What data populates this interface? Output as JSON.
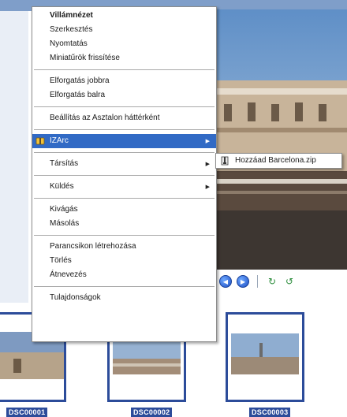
{
  "context_menu": {
    "items": [
      {
        "label": "Villámnézet",
        "bold": true
      },
      {
        "label": "Szerkesztés"
      },
      {
        "label": "Nyomtatás"
      },
      {
        "label": "Miniatűrök frissítése"
      },
      {
        "label": "Elforgatás jobbra"
      },
      {
        "label": "Elforgatás balra"
      },
      {
        "label": "Beállítás az Asztalon háttérként"
      },
      {
        "label": "IZArc",
        "icon": "izarc-icon",
        "submenu": true,
        "highlighted": true
      },
      {
        "label": "Társítás",
        "submenu": true
      },
      {
        "label": "Küldés",
        "submenu": true
      },
      {
        "label": "Kivágás"
      },
      {
        "label": "Másolás"
      },
      {
        "label": "Parancsikon létrehozása"
      },
      {
        "label": "Törlés"
      },
      {
        "label": "Átnevezés"
      },
      {
        "label": "Tulajdonságok"
      }
    ]
  },
  "submenu": {
    "items": [
      {
        "label": "Hozzáad Barcelona.zip",
        "icon": "archive-icon"
      }
    ]
  },
  "viewer_toolbar": {
    "buttons": [
      "previous-icon",
      "next-icon",
      "rotate-clockwise-icon",
      "rotate-counterclockwise-icon"
    ]
  },
  "filmstrip": {
    "labels": [
      "DSC00001",
      "DSC00002",
      "DSC00003"
    ]
  },
  "colors": {
    "highlight": "#316ac5",
    "thumb_border": "#2c4c9a",
    "menu_separator": "#a9a9a9"
  }
}
